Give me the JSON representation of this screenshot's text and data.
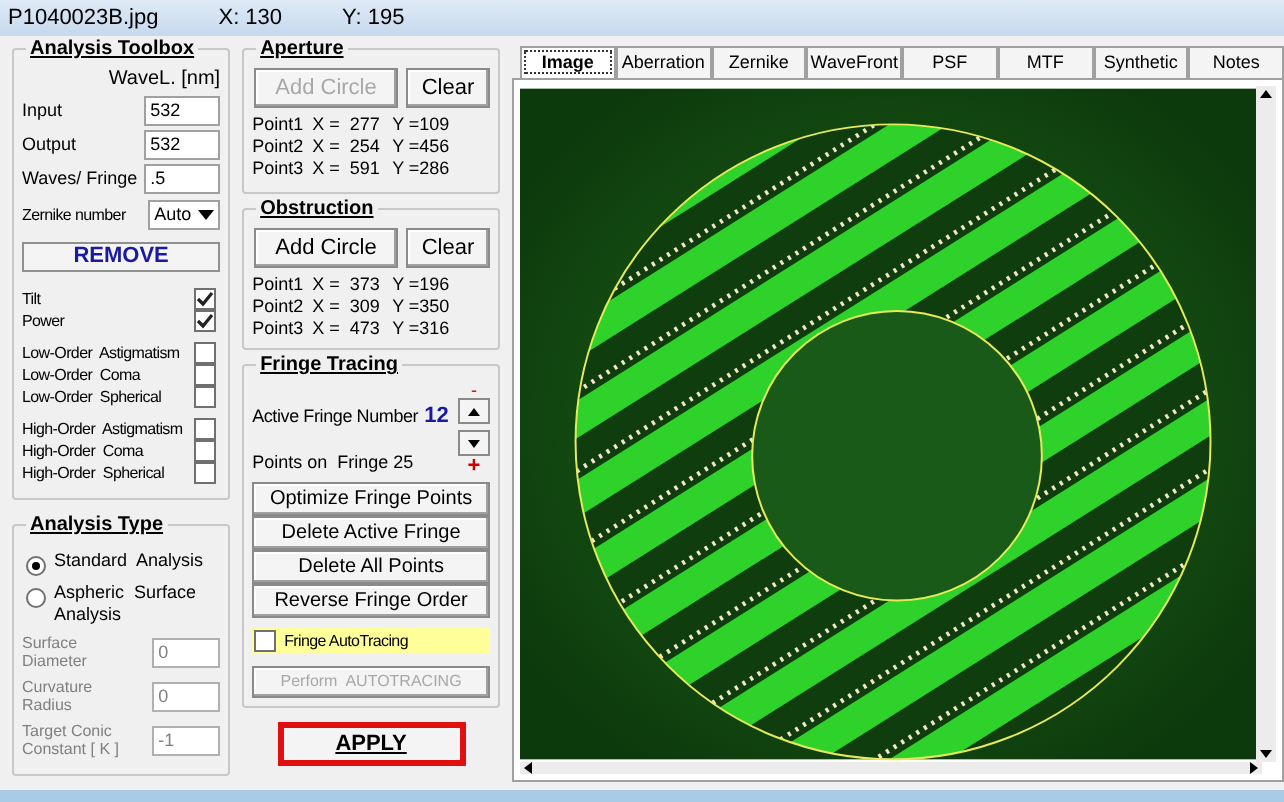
{
  "title_bar": {
    "filename": "P1040023B.jpg",
    "x": "X: 130",
    "y": "Y: 195"
  },
  "analysis_toolbox": {
    "title": "Analysis Toolbox",
    "wavelength_header": "WaveL. [nm]",
    "fields": [
      {
        "label": "Input",
        "value": "532"
      },
      {
        "label": "Output",
        "value": "532"
      },
      {
        "label": "Waves/ Fringe",
        "value": ".5"
      }
    ],
    "zernike": {
      "label": "Zernike number",
      "value": "Auto"
    },
    "remove_button": "REMOVE",
    "term_groups": [
      [
        {
          "label": "Tilt",
          "checked": true
        },
        {
          "label": "Power",
          "checked": true
        }
      ],
      [
        {
          "label": "Low-Order  Astigmatism",
          "checked": false
        },
        {
          "label": "Low-Order  Coma",
          "checked": false
        },
        {
          "label": "Low-Order  Spherical",
          "checked": false
        }
      ],
      [
        {
          "label": "High-Order  Astigmatism",
          "checked": false
        },
        {
          "label": "High-Order  Coma",
          "checked": false
        },
        {
          "label": "High-Order  Spherical",
          "checked": false
        }
      ]
    ]
  },
  "analysis_type": {
    "title": "Analysis Type",
    "options": [
      {
        "label": "Standard  Analysis",
        "selected": true
      },
      {
        "label": "Aspheric  Surface  Analysis",
        "selected": false
      }
    ],
    "fields": [
      {
        "label": "Surface Diameter",
        "value": "0",
        "disabled": true
      },
      {
        "label": "Curvature Radius",
        "value": "0",
        "disabled": true
      },
      {
        "label": "Target Conic Constant [ K ]",
        "value": "-1",
        "disabled": true
      }
    ]
  },
  "aperture": {
    "title": "Aperture",
    "buttons": [
      {
        "label": "Add Circle",
        "disabled": true
      },
      {
        "label": "Clear",
        "disabled": false
      }
    ],
    "points": [
      {
        "label": "Point1",
        "x": "X =  277",
        "y": "Y =109"
      },
      {
        "label": "Point2",
        "x": "X =  254",
        "y": "Y =456"
      },
      {
        "label": "Point3",
        "x": "X =  591",
        "y": "Y =286"
      }
    ]
  },
  "obstruction": {
    "title": "Obstruction",
    "buttons": [
      {
        "label": "Add Circle",
        "disabled": false
      },
      {
        "label": "Clear",
        "disabled": false
      }
    ],
    "points": [
      {
        "label": "Point1",
        "x": "X =  373",
        "y": "Y =196"
      },
      {
        "label": "Point2",
        "x": "X =  309",
        "y": "Y =350"
      },
      {
        "label": "Point3",
        "x": "X =  473",
        "y": "Y =316"
      }
    ]
  },
  "fringe_tracing": {
    "title": "Fringe Tracing",
    "minus_mark": "-",
    "plus_mark": "+",
    "active_label": "Active Fringe Number",
    "active_value": "12",
    "points_label": "Points on  Fringe 25",
    "buttons": [
      {
        "label": "Optimize Fringe Points",
        "disabled": false
      },
      {
        "label": "Delete Active Fringe",
        "disabled": false
      },
      {
        "label": "Delete  All  Points",
        "disabled": false
      },
      {
        "label": "Reverse  Fringe Order",
        "disabled": false
      }
    ],
    "autotracing": {
      "label": "Fringe AutoTracing",
      "checked": false
    },
    "perform_button": {
      "label": "Perform  AUTOTRACING",
      "disabled": true
    }
  },
  "apply_button": "APPLY",
  "tabs": [
    {
      "label": "Image",
      "selected": true
    },
    {
      "label": "Aberration",
      "selected": false
    },
    {
      "label": "Zernike",
      "selected": false
    },
    {
      "label": "WaveFront",
      "selected": false
    },
    {
      "label": "PSF",
      "selected": false
    },
    {
      "label": "MTF",
      "selected": false
    },
    {
      "label": "Synthetic",
      "selected": false
    },
    {
      "label": "Notes",
      "selected": false
    }
  ]
}
